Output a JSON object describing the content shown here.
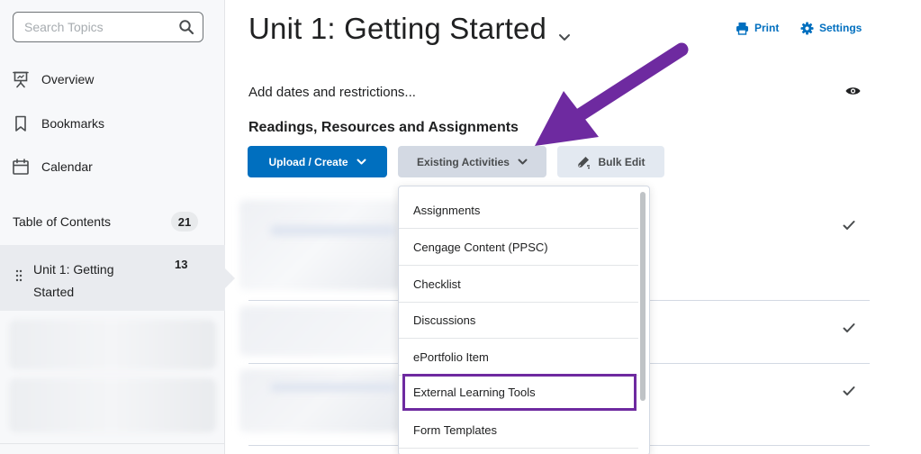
{
  "sidebar": {
    "search": {
      "placeholder": "Search Topics",
      "value": ""
    },
    "nav": [
      {
        "label": "Overview",
        "icon": "presentation-icon"
      },
      {
        "label": "Bookmarks",
        "icon": "bookmark-icon"
      },
      {
        "label": "Calendar",
        "icon": "calendar-icon"
      }
    ],
    "toc": {
      "label": "Table of Contents",
      "count": "21"
    },
    "unit": {
      "label": "Unit 1: Getting Started",
      "count": "13"
    }
  },
  "main": {
    "title": "Unit 1: Getting Started",
    "actions": {
      "print": "Print",
      "settings": "Settings"
    },
    "add_dates": "Add dates and restrictions...",
    "section_heading": "Readings, Resources and Assignments",
    "buttons": {
      "upload_create": "Upload / Create",
      "existing_activities": "Existing Activities",
      "bulk_edit": "Bulk Edit"
    },
    "dropdown_items": [
      "Assignments",
      "Cengage Content (PPSC)",
      "Checklist",
      "Discussions",
      "ePortfolio Item",
      "External Learning Tools",
      "Form Templates"
    ]
  },
  "colors": {
    "accent": "#006fbf",
    "annotation": "#6e2aa0"
  }
}
